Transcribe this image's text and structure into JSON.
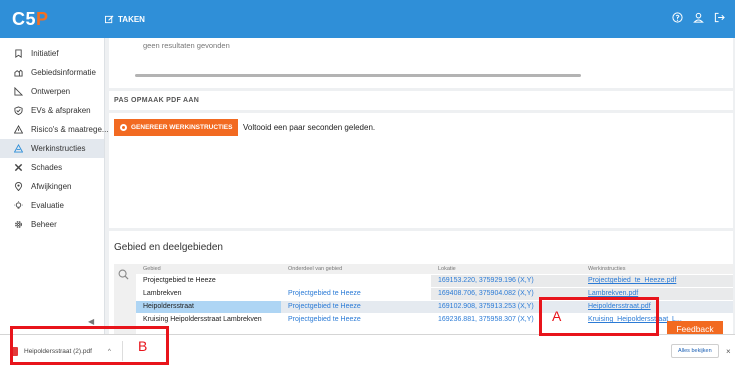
{
  "app": {
    "logo_main": "C5",
    "logo_accent": "P",
    "nav_label": "TAKEN"
  },
  "colors": {
    "topbar": "#2f8fd8",
    "accent": "#f26a21",
    "link": "#2b7bd6",
    "annotation": "#e8141b"
  },
  "sidebar": {
    "items": [
      {
        "label": "Initiatief",
        "icon": "bookmark-icon"
      },
      {
        "label": "Gebiedsinformatie",
        "icon": "houses-icon"
      },
      {
        "label": "Ontwerpen",
        "icon": "ruler-icon"
      },
      {
        "label": "EVs & afspraken",
        "icon": "check-shield-icon"
      },
      {
        "label": "Risico's & maatrege...",
        "icon": "warning-icon"
      },
      {
        "label": "Werkinstructies",
        "icon": "road-cone-icon"
      },
      {
        "label": "Schades",
        "icon": "tools-icon"
      },
      {
        "label": "Afwijkingen",
        "icon": "location-icon"
      },
      {
        "label": "Evaluatie",
        "icon": "lightbulb-icon"
      },
      {
        "label": "Beheer",
        "icon": "gear-icon"
      }
    ],
    "collapse_glyph": "◀"
  },
  "results": {
    "empty_message": "geen resultaten gevonden"
  },
  "pdf_section": {
    "title": "PAS OPMAAK PDF AAN"
  },
  "generate": {
    "button_label": "GENEREER WERKINSTRUCTIES",
    "status": "Voltooid een paar seconden geleden."
  },
  "areas": {
    "title": "Gebied en deelgebieden",
    "columns": [
      "Gebied",
      "Onderdeel van gebied",
      "Lokatie",
      "Werkinstructies"
    ],
    "rows": [
      [
        "Projectgebied te Heeze",
        "",
        "169153.220, 375929.196 (X,Y)",
        "Projectgebied_te_Heeze.pdf"
      ],
      [
        "Lambrekven",
        "Projectgebied te Heeze",
        "169408.706, 375904.082 (X,Y)",
        "Lambrekven.pdf"
      ],
      [
        "Heipoldersstraat",
        "Projectgebied te Heeze",
        "169102.908, 375913.253 (X,Y)",
        "Heipoldersstraat.pdf"
      ],
      [
        "Kruising Heipoldersstraat Lambrekven",
        "Projectgebied te Heeze",
        "169236.881, 375958.307 (X,Y)",
        "Kruising_Heipoldersstraat_L..."
      ]
    ]
  },
  "feedback_label": "Feedback",
  "downloads": {
    "file_name": "Heipoldersstraat (2).pdf",
    "expand_glyph": "^",
    "show_all_label": "Alles bekijken",
    "close_glyph": "×"
  },
  "annotations": {
    "a": "A",
    "b": "B"
  }
}
